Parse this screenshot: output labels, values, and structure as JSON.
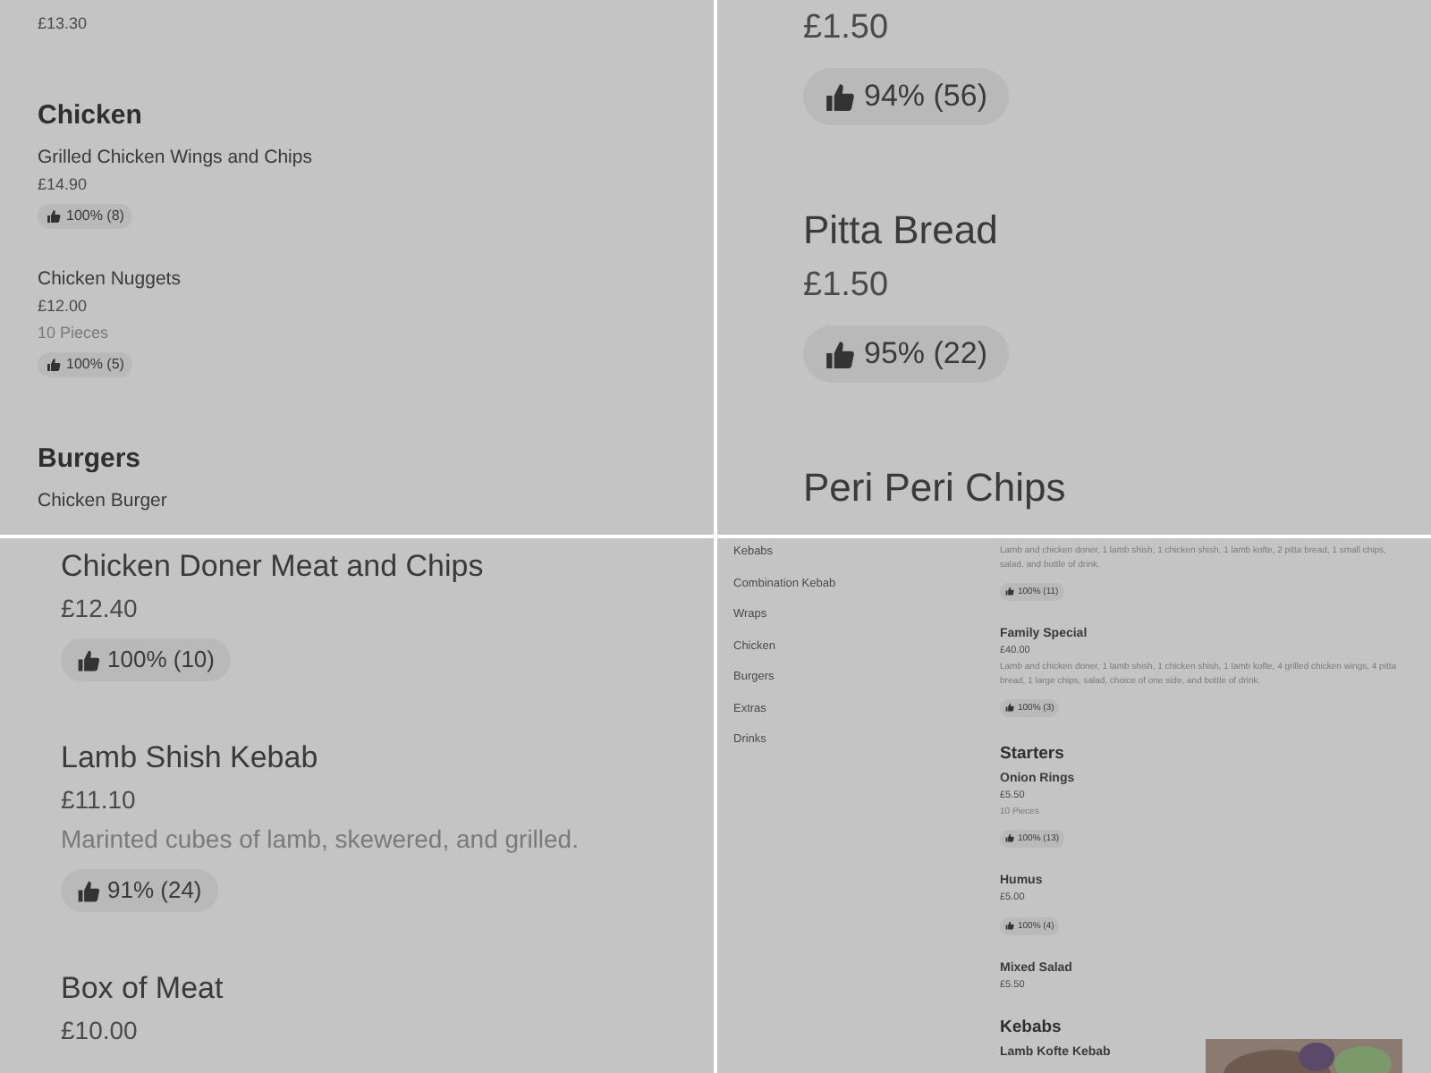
{
  "panels": [
    {
      "kind": "small",
      "entries": [
        {
          "kind": "dish",
          "price": "£13.30"
        },
        {
          "kind": "heading",
          "name": "Chicken"
        },
        {
          "kind": "dish",
          "name": "Grilled Chicken Wings and Chips",
          "price": "£14.90",
          "rating": "100% (8)"
        },
        {
          "kind": "dish",
          "name": "Chicken Nuggets",
          "price": "£12.00",
          "description": "10 Pieces",
          "rating": "100% (5)"
        },
        {
          "kind": "heading",
          "name": "Burgers"
        },
        {
          "kind": "dish",
          "name": "Chicken Burger"
        }
      ]
    },
    {
      "kind": "large",
      "entries": [
        {
          "kind": "dish",
          "price": "£1.50",
          "rating": "94% (56)"
        },
        {
          "kind": "dish",
          "name": "Pitta Bread",
          "price": "£1.50",
          "rating": "95% (22)"
        },
        {
          "kind": "dish",
          "name": "Peri Peri Chips"
        }
      ]
    },
    {
      "kind": "medium",
      "entries": [
        {
          "kind": "dish",
          "name": "Chicken Doner Meat and Chips",
          "price": "£12.40",
          "rating": "100% (10)"
        },
        {
          "kind": "dish",
          "name": "Lamb Shish Kebab",
          "price": "£11.10",
          "description": "Marinted cubes of lamb, skewered, and grilled.",
          "rating": "91% (24)"
        },
        {
          "kind": "dish",
          "name": "Box of Meat",
          "price": "£10.00"
        }
      ]
    },
    {
      "kind": "tiny",
      "sidebar": [
        "Kebabs",
        "Combination Kebab",
        "Wraps",
        "Chicken",
        "Burgers",
        "Extras",
        "Drinks"
      ],
      "entries": [
        {
          "kind": "dish",
          "description": "Lamb and chicken doner, 1 lamb shish, 1 chicken shish, 1 lamb kofte, 2 pitta bread, 1 small chips, salad, and bottle of drink.",
          "rating": "100% (11)"
        },
        {
          "kind": "dish",
          "name": "Family Special",
          "price": "£40.00",
          "description": "Lamb and chicken doner, 1 lamb shish, 1 chicken shish, 1 lamb kofte, 4 grilled chicken wings, 4 pitta bread, 1 large chips, salad, choice of one side, and bottle of drink.",
          "rating": "100% (3)"
        },
        {
          "kind": "heading",
          "name": "Starters"
        },
        {
          "kind": "dish",
          "name": "Onion Rings",
          "price": "£5.50",
          "description": "10 Pieces",
          "rating": "100% (13)"
        },
        {
          "kind": "dish",
          "name": "Humus",
          "price": "£5.00",
          "rating": "100% (4)"
        },
        {
          "kind": "dish",
          "name": "Mixed Salad",
          "price": "£5.50"
        },
        {
          "kind": "heading",
          "name": "Kebabs"
        },
        {
          "kind": "dish",
          "name": "Lamb Kofte Kebab",
          "photo": true
        }
      ]
    }
  ]
}
